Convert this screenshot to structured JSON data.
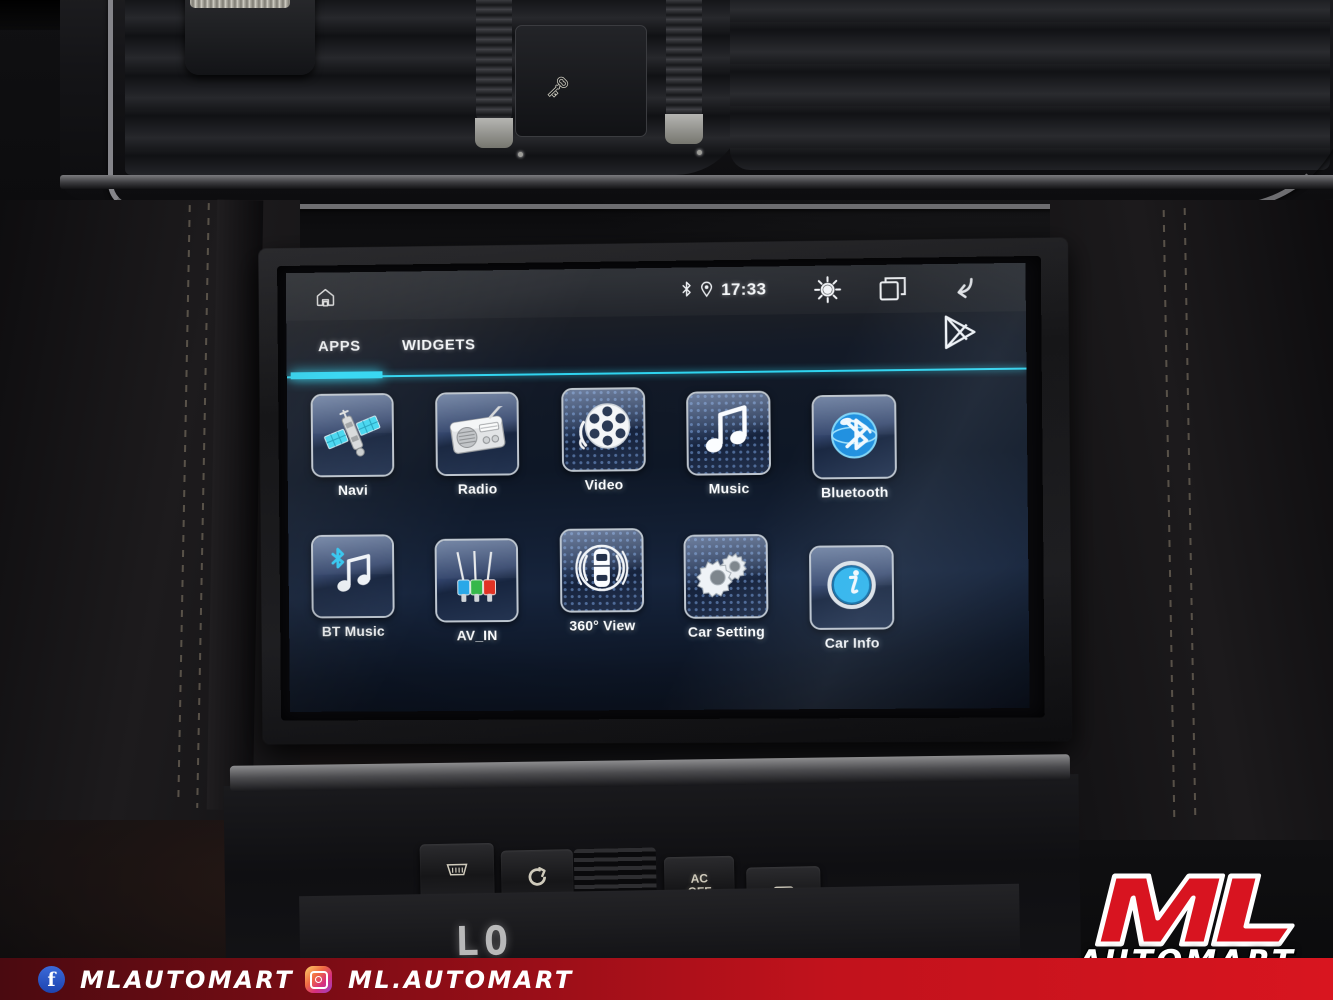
{
  "scene": {
    "title": "Porsche dashboard with Android head unit",
    "segment_display": "LO"
  },
  "head_unit": {
    "status_bar": {
      "home_icon": "home-icon",
      "bluetooth_icon": "bluetooth-icon",
      "location_icon": "location-pin-icon",
      "time": "17:33",
      "brightness_icon": "brightness-sun-icon",
      "recents_icon": "recent-apps-icon",
      "back_icon": "back-arrow-icon"
    },
    "tabs": [
      {
        "label": "APPS",
        "active": true
      },
      {
        "label": "WIDGETS",
        "active": false
      }
    ],
    "playstore_icon": "play-store-icon",
    "accent_color": "#30d6f2",
    "apps": [
      {
        "label": "Navi",
        "icon": "satellite-icon"
      },
      {
        "label": "Radio",
        "icon": "radio-icon"
      },
      {
        "label": "Video",
        "icon": "film-reel-icon"
      },
      {
        "label": "Music",
        "icon": "music-note-icon"
      },
      {
        "label": "Bluetooth",
        "icon": "bluetooth-globe-icon"
      },
      {
        "label": "BT Music",
        "icon": "bt-music-icon"
      },
      {
        "label": "AV_IN",
        "icon": "rca-cables-icon"
      },
      {
        "label": "360° View",
        "icon": "surround-view-car-icon"
      },
      {
        "label": "Car Setting",
        "icon": "gears-icon"
      },
      {
        "label": "Car Info",
        "icon": "info-circle-icon"
      }
    ]
  },
  "climate_controls": [
    {
      "label": "",
      "glyph": "▒",
      "icon": "front-defrost-icon"
    },
    {
      "label": "",
      "glyph": "↻",
      "icon": "air-recirculation-icon"
    },
    {
      "label": "",
      "glyph": "",
      "icon": "vent-grille"
    },
    {
      "label": "AC\nOFF",
      "glyph": "",
      "icon": "ac-off-button"
    },
    {
      "label": "",
      "glyph": "▓",
      "icon": "rear-defrost-icon"
    }
  ],
  "watermark": {
    "logo_main": "ML",
    "logo_sub": "AUTOMART",
    "brand_red": "#d8151f",
    "facebook": {
      "icon": "facebook-icon",
      "handle": "MLAUTOMART"
    },
    "instagram": {
      "icon": "instagram-icon",
      "handle": "ML.AUTOMART"
    }
  }
}
